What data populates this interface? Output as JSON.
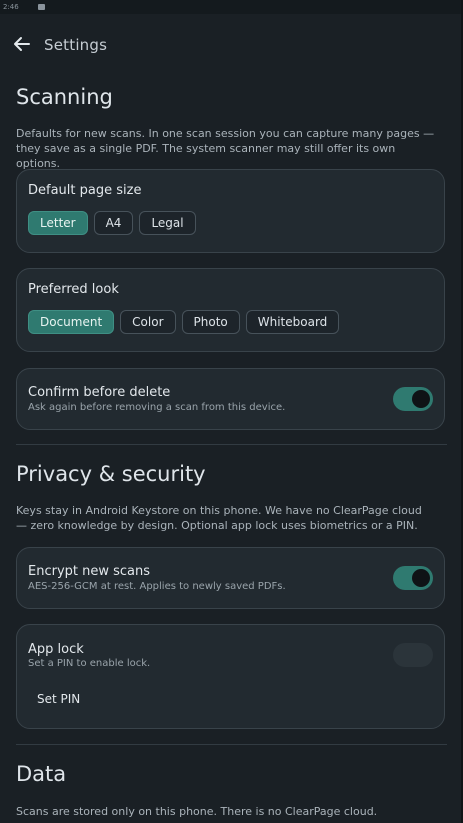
{
  "status_bar": {
    "text": "2:46"
  },
  "header": {
    "title": "Settings"
  },
  "scanning": {
    "title": "Scanning",
    "description": "Defaults for new scans. In one scan session you can capture many pages — they save as a single PDF. The system scanner may still offer its own options.",
    "page_size": {
      "title": "Default page size",
      "options": [
        "Letter",
        "A4",
        "Legal"
      ],
      "selected": "Letter"
    },
    "look": {
      "title": "Preferred look",
      "options": [
        "Document",
        "Color",
        "Photo",
        "Whiteboard"
      ],
      "selected": "Document"
    },
    "confirm_delete": {
      "title": "Confirm before delete",
      "subtitle": "Ask again before removing a scan from this device.",
      "enabled": true
    }
  },
  "privacy": {
    "title": "Privacy & security",
    "description": "Keys stay in Android Keystore on this phone. We have no ClearPage cloud — zero knowledge by design. Optional app lock uses biometrics or a PIN.",
    "encrypt": {
      "title": "Encrypt new scans",
      "subtitle": "AES-256-GCM at rest. Applies to newly saved PDFs.",
      "enabled": true
    },
    "app_lock": {
      "title": "App lock",
      "subtitle": "Set a PIN to enable lock.",
      "enabled": false,
      "set_pin_label": "Set PIN"
    }
  },
  "data": {
    "title": "Data",
    "description": "Scans are stored only on this phone. There is no ClearPage cloud."
  },
  "colors": {
    "background": "#1a2025",
    "card": "#222a30",
    "accent": "#2f7a70"
  }
}
